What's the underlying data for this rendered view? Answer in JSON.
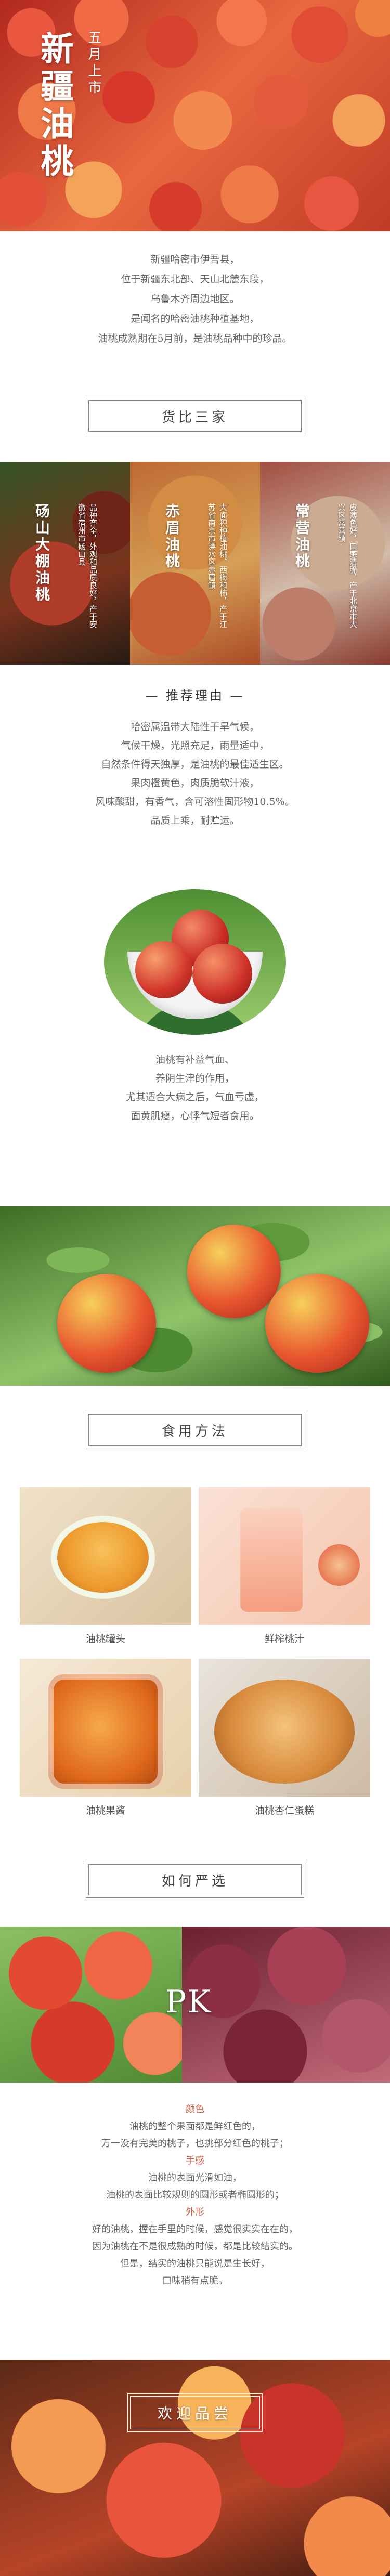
{
  "hero": {
    "title": "新疆油桃",
    "subtitle": "五月上市"
  },
  "intro": {
    "lines": [
      "新疆哈密市伊吾县，",
      "位于新疆东北部、天山北麓东段，",
      "乌鲁木齐周边地区。",
      "是闻名的哈密油桃种植基地，",
      "油桃成熟期在5月前，是油桃品种中的珍品。"
    ]
  },
  "compare": {
    "heading": "货比三家",
    "panels": [
      {
        "name": "砀山大棚油桃",
        "desc": "品种齐全，外观和品质良好，产于安徽省宿州市砀山县"
      },
      {
        "name": "赤眉油桃",
        "desc": "大面积种植油桃、西梅和柿，产于江苏省南京市溧水区赤眉镇"
      },
      {
        "name": "常营油桃",
        "desc": "皮薄色好，口感清脆，产于北京市大兴区常营镇"
      }
    ]
  },
  "reasons": {
    "heading": "推荐理由",
    "lines": [
      "哈密属温带大陆性干旱气候，",
      "气候干燥，光照充足，雨量适中，",
      "自然条件得天独厚，是油桃的最佳适生区。",
      "果肉橙黄色，肉质脆软汁液，",
      "风味酸甜，有香气，含可溶性固形物10.5%。",
      "品质上乘，耐贮运。"
    ]
  },
  "benefits": {
    "lines": [
      "油桃有补益气血、",
      "养阴生津的作用，",
      "尤其适合大病之后，气血亏虚，",
      "面黄肌瘦，心悸气短者食用。"
    ]
  },
  "recipes": {
    "heading": "食用方法",
    "items": [
      {
        "label": "油桃罐头"
      },
      {
        "label": "鲜榨桃汁"
      },
      {
        "label": "油桃果酱"
      },
      {
        "label": "油桃杏仁蛋糕"
      }
    ]
  },
  "select": {
    "heading": "如何严选",
    "pk": "PK",
    "color_label": "颜色",
    "color_lines": [
      "油桃的整个果面都是鲜红色的，",
      "万一没有完美的桃子，也挑部分红色的桃子；"
    ],
    "feel_label": "手感",
    "feel_lines": [
      "油桃的表面光滑如油，",
      "油桃的表面比较规则的圆形或者椭圆形的；"
    ],
    "shape_label": "外形",
    "shape_lines": [
      "好的油桃，握在手里的时候，感觉很实实在在的，",
      "因为油桃在不是很成熟的时候，都是比较结实的。",
      "但是，结实的油桃只能说是生长好，",
      "口味稍有点脆。"
    ]
  },
  "footer": {
    "welcome": "欢迎品尝"
  },
  "colors": {
    "accent": "#c8614a",
    "text": "#666666"
  }
}
